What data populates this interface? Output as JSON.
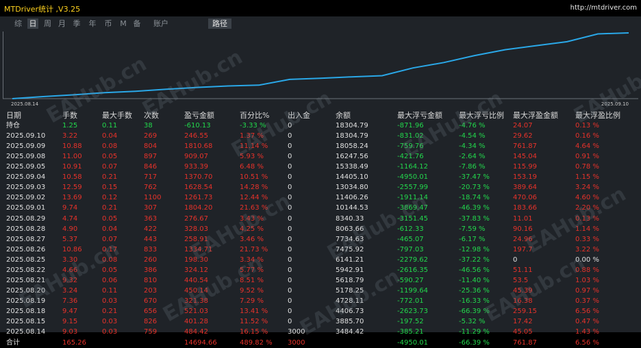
{
  "app": {
    "title": "MTDriver统计 ,V3.25",
    "url": "http://mtdriver.com"
  },
  "tabs": [
    {
      "label": "综"
    },
    {
      "label": "日"
    },
    {
      "label": "周"
    },
    {
      "label": "月"
    },
    {
      "label": "季"
    },
    {
      "label": "年"
    },
    {
      "label": "币"
    },
    {
      "label": "M"
    },
    {
      "label": "备"
    },
    {
      "label": "账户"
    },
    {
      "label": "路径"
    }
  ],
  "active_tabs": [
    "日",
    "路径"
  ],
  "chart_data": {
    "type": "line",
    "x": [
      "2025.08.14",
      "2025.08.15",
      "2025.08.18",
      "2025.08.19",
      "2025.08.20",
      "2025.08.21",
      "2025.08.22",
      "2025.08.25",
      "2025.08.26",
      "2025.08.27",
      "2025.08.28",
      "2025.08.29",
      "2025.09.01",
      "2025.09.02",
      "2025.09.03",
      "2025.09.04",
      "2025.09.05",
      "2025.09.08",
      "2025.09.09",
      "2025.09.10",
      "2025.09.10"
    ],
    "series": [
      {
        "values": [
          0,
          484.42,
          885.67,
          1406.7,
          1728.08,
          2178.22,
          2618.76,
          2942.88,
          3141.18,
          4475.89,
          4734.8,
          5062.83,
          5339.5,
          7143.7,
          8405.43,
          10033.97,
          11404.67,
          12338.06,
          13247.13,
          15057.81,
          15304.36
        ]
      }
    ],
    "x_start_label": "2025.08.14",
    "x_end_label": "2025.09.10",
    "line_color": "#2aa8e8"
  },
  "table": {
    "headers": [
      "日期",
      "手数",
      "最大手数",
      "次数",
      "盈亏金额",
      "百分比%",
      "出入金",
      "余额",
      "最大浮亏金额",
      "最大浮亏比例",
      "最大浮盈金额",
      "最大浮盈比例"
    ],
    "holding": {
      "cells": [
        "持仓",
        "1.25",
        "0.11",
        "38",
        "-610.13",
        "-3.33 %",
        "0",
        "18304.79",
        "-871.96",
        "-4.76 %",
        "24.07",
        "0.13 %"
      ],
      "colors": [
        "white",
        "green",
        "green",
        "green",
        "green",
        "green",
        "white",
        "white",
        "green",
        "green",
        "red",
        "red"
      ]
    },
    "rows": [
      [
        "2025.09.10",
        "3.22",
        "0.04",
        "269",
        "246.55",
        "1.37 %",
        "0",
        "18304.79",
        "-831.02",
        "-4.54 %",
        "29.62",
        "0.16 %"
      ],
      [
        "2025.09.09",
        "10.88",
        "0.08",
        "804",
        "1810.68",
        "11.14 %",
        "0",
        "18058.24",
        "-759.76",
        "-4.34 %",
        "761.87",
        "4.64 %"
      ],
      [
        "2025.09.08",
        "11.00",
        "0.05",
        "897",
        "909.07",
        "5.93 %",
        "0",
        "16247.56",
        "-421.76",
        "-2.64 %",
        "145.04",
        "0.91 %"
      ],
      [
        "2025.09.05",
        "10.91",
        "0.07",
        "846",
        "933.39",
        "6.48 %",
        "0",
        "15338.49",
        "-1164.12",
        "-7.86 %",
        "115.99",
        "0.78 %"
      ],
      [
        "2025.09.04",
        "10.58",
        "0.21",
        "717",
        "1370.70",
        "10.51 %",
        "0",
        "14405.10",
        "-4950.01",
        "-37.47 %",
        "153.19",
        "1.15 %"
      ],
      [
        "2025.09.03",
        "12.59",
        "0.15",
        "762",
        "1628.54",
        "14.28 %",
        "0",
        "13034.80",
        "-2557.99",
        "-20.73 %",
        "389.64",
        "3.24 %"
      ],
      [
        "2025.09.02",
        "13.69",
        "0.12",
        "1100",
        "1261.73",
        "12.44 %",
        "0",
        "11406.26",
        "-1911.14",
        "-18.74 %",
        "470.06",
        "4.60 %"
      ],
      [
        "2025.09.01",
        "9.74",
        "0.21",
        "307",
        "1804.20",
        "21.63 %",
        "0",
        "10144.53",
        "-3869.47",
        "-46.39 %",
        "183.66",
        "2.20 %"
      ],
      [
        "2025.08.29",
        "4.74",
        "0.05",
        "363",
        "276.67",
        "3.43 %",
        "0",
        "8340.33",
        "-3151.45",
        "-37.83 %",
        "11.01",
        "0.13 %"
      ],
      [
        "2025.08.28",
        "4.90",
        "0.04",
        "422",
        "328.03",
        "4.25 %",
        "0",
        "8063.66",
        "-612.33",
        "-7.59 %",
        "90.16",
        "1.14 %"
      ],
      [
        "2025.08.27",
        "5.37",
        "0.07",
        "443",
        "258.91",
        "3.46 %",
        "0",
        "7734.63",
        "-465.07",
        "-6.17 %",
        "24.96",
        "0.33 %"
      ],
      [
        "2025.08.26",
        "10.86",
        "0.17",
        "833",
        "1334.71",
        "21.73 %",
        "0",
        "7475.92",
        "-797.03",
        "-12.98 %",
        "197.7",
        "3.22 %"
      ],
      [
        "2025.08.25",
        "3.30",
        "0.08",
        "260",
        "198.30",
        "3.34 %",
        "0",
        "6141.21",
        "-2279.62",
        "-37.22 %",
        "0",
        "0.00 %"
      ],
      [
        "2025.08.22",
        "4.66",
        "0.05",
        "386",
        "324.12",
        "5.77 %",
        "0",
        "5942.91",
        "-2616.35",
        "-46.56 %",
        "51.11",
        "0.88 %"
      ],
      [
        "2025.08.21",
        "9.32",
        "0.06",
        "810",
        "440.54",
        "8.51 %",
        "0",
        "5618.79",
        "-590.27",
        "-11.40 %",
        "53.5",
        "1.03 %"
      ],
      [
        "2025.08.20",
        "3.24",
        "0.11",
        "203",
        "450.14",
        "9.52 %",
        "0",
        "5178.25",
        "-1199.64",
        "-25.36 %",
        "45.39",
        "0.97 %"
      ],
      [
        "2025.08.19",
        "7.36",
        "0.03",
        "670",
        "321.38",
        "7.29 %",
        "0",
        "4728.11",
        "-772.01",
        "-16.33 %",
        "16.38",
        "0.37 %"
      ],
      [
        "2025.08.18",
        "9.47",
        "0.21",
        "656",
        "521.03",
        "13.41 %",
        "0",
        "4406.73",
        "-2623.73",
        "-66.39 %",
        "259.15",
        "6.56 %"
      ],
      [
        "2025.08.15",
        "9.15",
        "0.03",
        "826",
        "401.28",
        "11.52 %",
        "0",
        "3885.70",
        "-197.52",
        "-5.32 %",
        "17.42",
        "0.47 %"
      ],
      [
        "2025.08.14",
        "9.03",
        "0.03",
        "759",
        "484.42",
        "16.15 %",
        "3000",
        "3484.42",
        "-385.21",
        "-11.29 %",
        "45.05",
        "1.43 %"
      ]
    ],
    "row_colors": [
      "white",
      "red",
      "red",
      "red",
      "red",
      "red",
      "white",
      "white",
      "green",
      "green",
      "red",
      "red"
    ],
    "special_colors": {
      "2025.08.25": {
        "10": "white",
        "11": "white"
      }
    },
    "total": {
      "cells": [
        "合计",
        "165.26",
        "",
        "",
        "14694.66",
        "489.82 %",
        "3000",
        "",
        "-4950.01",
        "-66.39 %",
        "761.87",
        "6.56 %"
      ],
      "colors": [
        "white",
        "red",
        "red",
        "red",
        "red",
        "red",
        "red",
        "white",
        "green",
        "green",
        "red",
        "red"
      ]
    }
  },
  "watermark": "EAHub.cn",
  "colors": {
    "positive": "#e8322a",
    "negative": "#22d84c",
    "line": "#2aa8e8"
  }
}
